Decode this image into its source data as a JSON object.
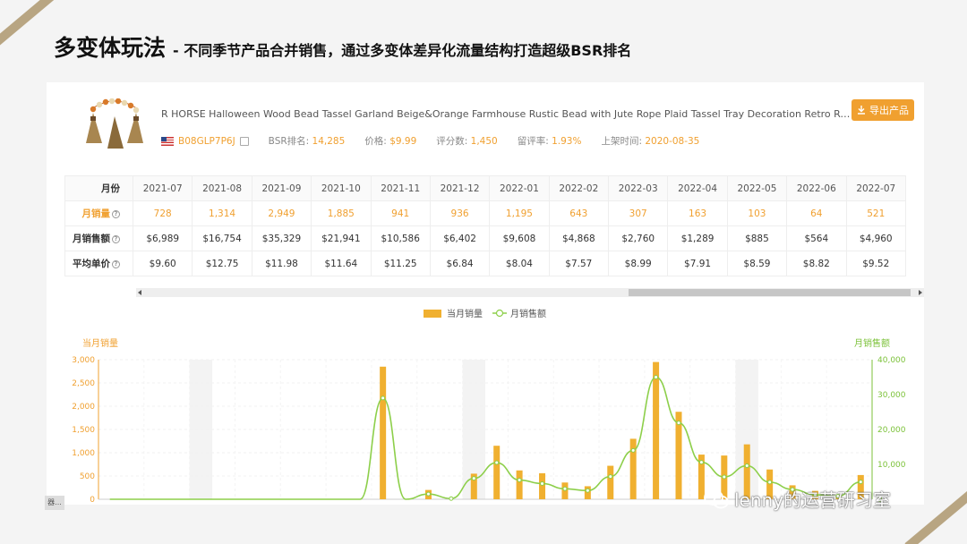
{
  "slide": {
    "title": "多变体玩法",
    "subtitle": "- 不同季节产品合并销售，通过多变体差异化流量结构打造超级BSR排名"
  },
  "product": {
    "title": "R HORSE Halloween Wood Bead Tassel Garland Beige&Orange Farmhouse Rustic Bead with Jute Rope Plaid Tassel Tray Decoration Retro Room Decor",
    "export_label": "导出产品",
    "asin": "B08GLP7P6J",
    "bsr_label": "BSR排名:",
    "bsr_value": "14,285",
    "price_label": "价格:",
    "price_value": "$9.99",
    "reviews_label": "评分数:",
    "reviews_value": "1,450",
    "rating_rate_label": "留评率:",
    "rating_rate_value": "1.93%",
    "launch_label": "上架时间:",
    "launch_value": "2020-08-35",
    "flag_icon": "us-flag-icon",
    "accent_color": "#f0a030"
  },
  "table": {
    "month_label": "月份",
    "months": [
      "2021-07",
      "2021-08",
      "2021-09",
      "2021-10",
      "2021-11",
      "2021-12",
      "2022-01",
      "2022-02",
      "2022-03",
      "2022-04",
      "2022-05",
      "2022-06",
      "2022-07"
    ],
    "rows": [
      {
        "label": "月销量",
        "highlight": true,
        "values": [
          "728",
          "1,314",
          "2,949",
          "1,885",
          "941",
          "936",
          "1,195",
          "643",
          "307",
          "163",
          "103",
          "64",
          "521"
        ]
      },
      {
        "label": "月销售额",
        "highlight": false,
        "values": [
          "$6,989",
          "$16,754",
          "$35,329",
          "$21,941",
          "$10,586",
          "$6,402",
          "$9,608",
          "$4,868",
          "$2,760",
          "$1,289",
          "$885",
          "$564",
          "$4,960"
        ]
      },
      {
        "label": "平均单价",
        "highlight": false,
        "values": [
          "$9.60",
          "$12.75",
          "$11.98",
          "$11.64",
          "$11.25",
          "$6.84",
          "$8.04",
          "$7.57",
          "$8.99",
          "$7.91",
          "$8.59",
          "$8.82",
          "$9.52"
        ]
      }
    ]
  },
  "chart_data": {
    "type": "bar",
    "legend": [
      "当月销量",
      "月销售额"
    ],
    "legend_position": "top-center",
    "y_left_label": "当月销量",
    "y_right_label": "月销售额",
    "y_left_ticks": [
      "0",
      "500",
      "1,000",
      "1,500",
      "2,000",
      "2,500",
      "3,000"
    ],
    "y_right_ticks": [
      "0",
      "10,000",
      "20,000",
      "30,000",
      "40,000"
    ],
    "ylim_left": [
      0,
      3000
    ],
    "ylim_right": [
      0,
      40000
    ],
    "grid": true,
    "bar_color": "#f0b030",
    "line_color": "#8dcf4a",
    "series": [
      {
        "name": "当月销量",
        "type": "bar",
        "values": [
          0,
          0,
          0,
          0,
          0,
          0,
          0,
          0,
          0,
          0,
          0,
          0,
          2850,
          0,
          200,
          0,
          550,
          1150,
          620,
          560,
          360,
          280,
          720,
          1300,
          2950,
          1880,
          960,
          940,
          1180,
          640,
          300,
          180,
          80,
          521
        ]
      },
      {
        "name": "月销售额",
        "type": "line",
        "values": [
          0,
          0,
          0,
          0,
          0,
          0,
          0,
          0,
          0,
          0,
          0,
          0,
          29000,
          0,
          1500,
          200,
          6000,
          10500,
          5500,
          4500,
          3000,
          2500,
          6500,
          14000,
          35000,
          21900,
          10600,
          6400,
          9600,
          4900,
          2800,
          1300,
          900,
          4960
        ]
      }
    ],
    "shaded_bands": [
      4,
      16,
      28
    ]
  },
  "watermark": "lenny的运营研习室",
  "corner_tag": "器..."
}
